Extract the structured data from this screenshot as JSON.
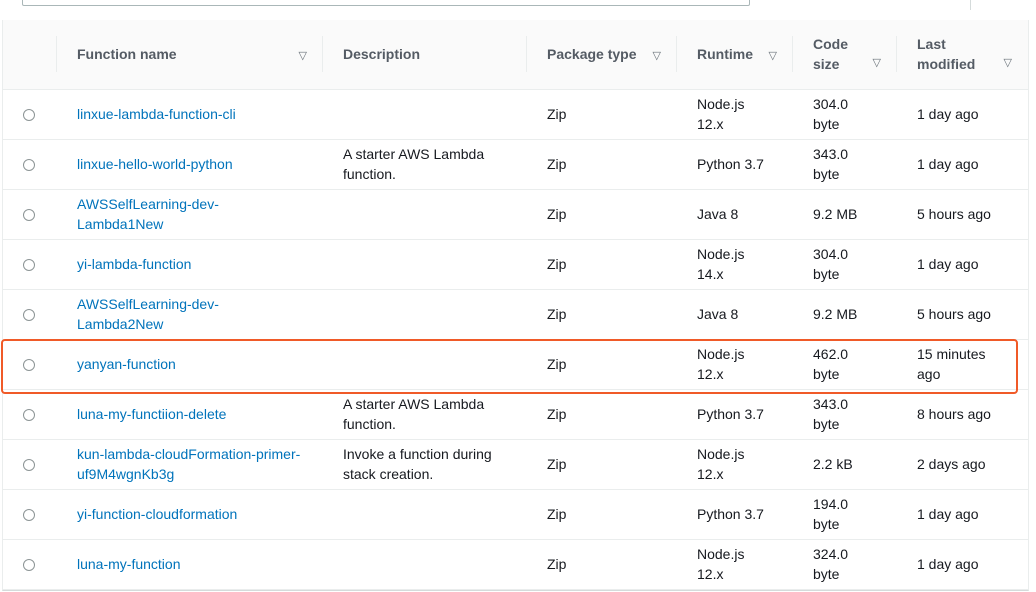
{
  "columns": {
    "name": "Function name",
    "description": "Description",
    "package": "Package type",
    "runtime": "Runtime",
    "size_line1": "Code",
    "size_line2": "size",
    "modified_line1": "Last",
    "modified_line2": "modified",
    "sort_icon": "▽"
  },
  "functions": [
    {
      "name": "linxue-lambda-function-cli",
      "description": "",
      "package": "Zip",
      "runtime": "Node.js 12.x",
      "size": "304.0 byte",
      "modified": "1 day ago"
    },
    {
      "name": "linxue-hello-world-python",
      "description": "A starter AWS Lambda function.",
      "package": "Zip",
      "runtime": "Python 3.7",
      "size": "343.0 byte",
      "modified": "1 day ago"
    },
    {
      "name": "AWSSelfLearning-dev-Lambda1New",
      "description": "",
      "package": "Zip",
      "runtime": "Java 8",
      "size": "9.2 MB",
      "modified": "5 hours ago"
    },
    {
      "name": "yi-lambda-function",
      "description": "",
      "package": "Zip",
      "runtime": "Node.js 14.x",
      "size": "304.0 byte",
      "modified": "1 day ago"
    },
    {
      "name": "AWSSelfLearning-dev-Lambda2New",
      "description": "",
      "package": "Zip",
      "runtime": "Java 8",
      "size": "9.2 MB",
      "modified": "5 hours ago"
    },
    {
      "name": "yanyan-function",
      "description": "",
      "package": "Zip",
      "runtime": "Node.js 12.x",
      "size": "462.0 byte",
      "modified": "15 minutes ago"
    },
    {
      "name": "luna-my-functiion-delete",
      "description": "A starter AWS Lambda function.",
      "package": "Zip",
      "runtime": "Python 3.7",
      "size": "343.0 byte",
      "modified": "8 hours ago"
    },
    {
      "name": "kun-lambda-cloudFormation-primer-uf9M4wgnKb3g",
      "description": "Invoke a function during stack creation.",
      "package": "Zip",
      "runtime": "Node.js 12.x",
      "size": "2.2 kB",
      "modified": "2 days ago"
    },
    {
      "name": "yi-function-cloudformation",
      "description": "",
      "package": "Zip",
      "runtime": "Python 3.7",
      "size": "194.0 byte",
      "modified": "1 day ago"
    },
    {
      "name": "luna-my-function",
      "description": "",
      "package": "Zip",
      "runtime": "Node.js 12.x",
      "size": "324.0 byte",
      "modified": "1 day ago"
    }
  ],
  "highlight_color": "#f05a28",
  "link_color": "#0073bb"
}
